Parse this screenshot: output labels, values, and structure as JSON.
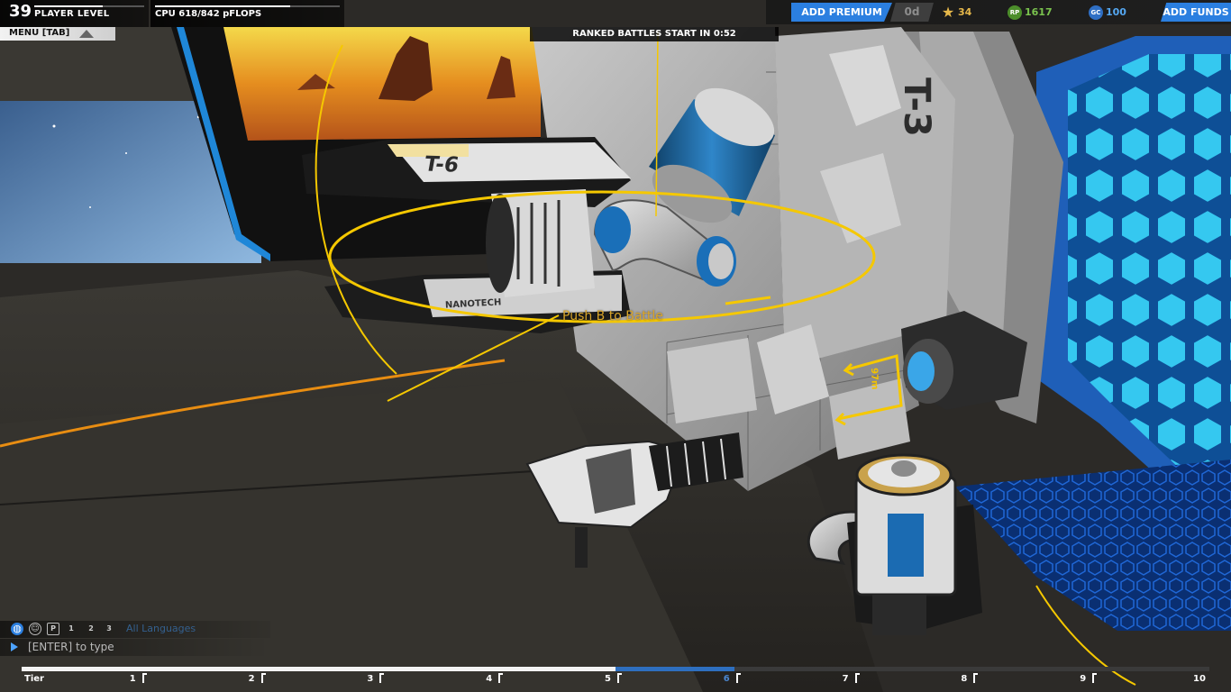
{
  "player": {
    "level": "39",
    "level_label": "PLAYER LEVEL",
    "level_progress": 0.62
  },
  "cpu": {
    "text": "CPU 618/842 pFLOPS",
    "used": 618,
    "max": 842
  },
  "menu": {
    "label": "MENU [TAB]"
  },
  "ranked": {
    "text": "RANKED BATTLES START IN 0:52"
  },
  "currencies": {
    "premium_button": "ADD PREMIUM",
    "premium_days": "0d",
    "tech_points": "34",
    "robits": "1617",
    "robits_icon": "RP",
    "galaxy_coins": "100",
    "galaxy_icon": "GC",
    "funds_button": "ADD FUNDS"
  },
  "world": {
    "prompt": "Push B to Battle",
    "decal_t6": "T-6",
    "decal_nanotech": "NANOTECH",
    "decal_t3": "T-3",
    "distance": "97m"
  },
  "chat": {
    "filter_icons": [
      "globe-icon",
      "person-icon",
      "p-icon",
      "1",
      "2",
      "3"
    ],
    "filter_selected": "All Languages",
    "placeholder": "[ENTER] to type"
  },
  "tier_bar": {
    "label": "Tier",
    "tiers": [
      "1",
      "2",
      "3",
      "4",
      "5",
      "6",
      "7",
      "8",
      "9",
      "10"
    ],
    "current": "6",
    "progress": 0.52
  },
  "colors": {
    "accent": "#2b7fe0",
    "hologram": "#f5c800",
    "tech": "#e6b84a",
    "robits": "#7ac24e",
    "galaxy": "#55a8f2"
  }
}
